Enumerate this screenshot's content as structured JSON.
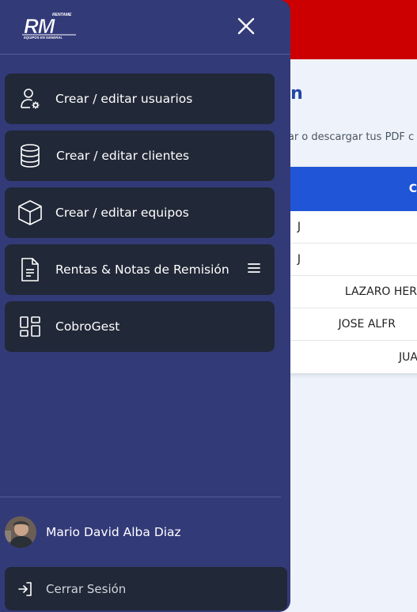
{
  "background": {
    "title_fragment": "ón",
    "subtitle_fragment": "inar o descargar tus PDF c",
    "table_header_fragment": "C",
    "rows": [
      "J",
      "J",
      "LAZARO HER",
      "JOSE ALFR",
      "JUA"
    ]
  },
  "drawer": {
    "logo_text": "RM",
    "logo_top_text": "RENTAME",
    "logo_bottom_text": "EQUIPOS EN GENERAL",
    "nav": [
      {
        "label": "Crear / editar usuarios",
        "icon": "user-gear-icon"
      },
      {
        "label": "Crear / editar clientes",
        "icon": "database-icon"
      },
      {
        "label": "Crear / editar equipos",
        "icon": "box-icon"
      },
      {
        "label": "Rentas & Notas de Remisión",
        "icon": "document-icon"
      },
      {
        "label": "CobroGest",
        "icon": "dashboard-icon"
      }
    ],
    "user_name": "Mario David Alba Diaz",
    "logout_label": "Cerrar Sesión"
  },
  "colors": {
    "drawer_bg": "#333a78",
    "nav_item_bg": "#212837",
    "topbar_red": "#cc0000",
    "table_header_blue": "#1f55d6",
    "title_blue": "#2247a6"
  }
}
